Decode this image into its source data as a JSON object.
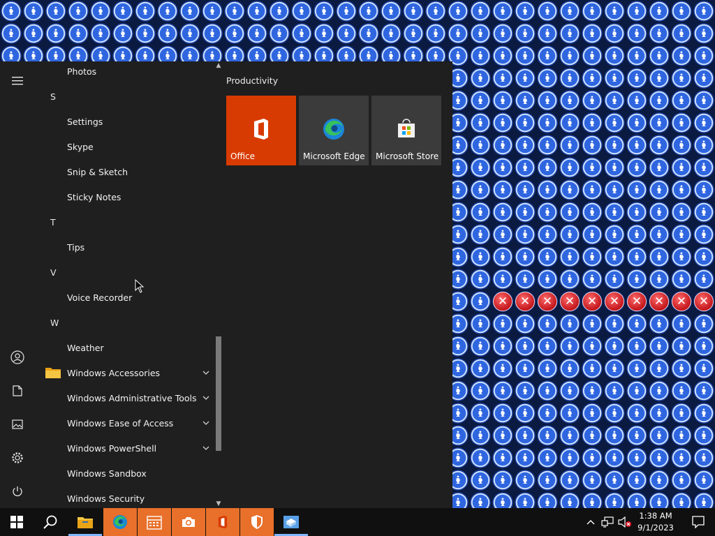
{
  "app_list": {
    "items": [
      {
        "type": "app",
        "label": "Photos"
      },
      {
        "type": "letter",
        "label": "S"
      },
      {
        "type": "app",
        "label": "Settings"
      },
      {
        "type": "app",
        "label": "Skype"
      },
      {
        "type": "app",
        "label": "Snip & Sketch"
      },
      {
        "type": "app",
        "label": "Sticky Notes"
      },
      {
        "type": "letter",
        "label": "T"
      },
      {
        "type": "app",
        "label": "Tips"
      },
      {
        "type": "letter",
        "label": "V"
      },
      {
        "type": "app",
        "label": "Voice Recorder"
      },
      {
        "type": "letter",
        "label": "W"
      },
      {
        "type": "app",
        "label": "Weather"
      },
      {
        "type": "folder",
        "label": "Windows Accessories"
      },
      {
        "type": "folder",
        "label": "Windows Administrative Tools"
      },
      {
        "type": "folder",
        "label": "Windows Ease of Access"
      },
      {
        "type": "folder",
        "label": "Windows PowerShell"
      },
      {
        "type": "app",
        "label": "Windows Sandbox"
      },
      {
        "type": "app",
        "label": "Windows Security"
      }
    ]
  },
  "tiles": {
    "group_title": "Productivity",
    "items": [
      {
        "label": "Office",
        "color": "#d83b01",
        "icon": "office-icon"
      },
      {
        "label": "Microsoft Edge",
        "color": "#3b3b3b",
        "icon": "edge-icon"
      },
      {
        "label": "Microsoft Store",
        "color": "#3b3b3b",
        "icon": "store-icon"
      }
    ]
  },
  "rail": {
    "items": [
      "hamburger-icon",
      "user-icon",
      "documents-icon",
      "pictures-icon",
      "settings-icon",
      "power-icon"
    ]
  },
  "taskbar": {
    "items": [
      "start-icon",
      "search-icon",
      "file-explorer-icon",
      "edge-icon",
      "calendar-icon",
      "camera-icon",
      "office-icon",
      "security-icon",
      "sandbox-icon"
    ],
    "clock_time": "1:38 AM",
    "clock_date": "9/1/2023"
  },
  "colors": {
    "start_bg": "#1f1f1f",
    "accent_orange": "#e8702a",
    "office_red": "#d83b01",
    "tile_gray": "#3b3b3b"
  }
}
